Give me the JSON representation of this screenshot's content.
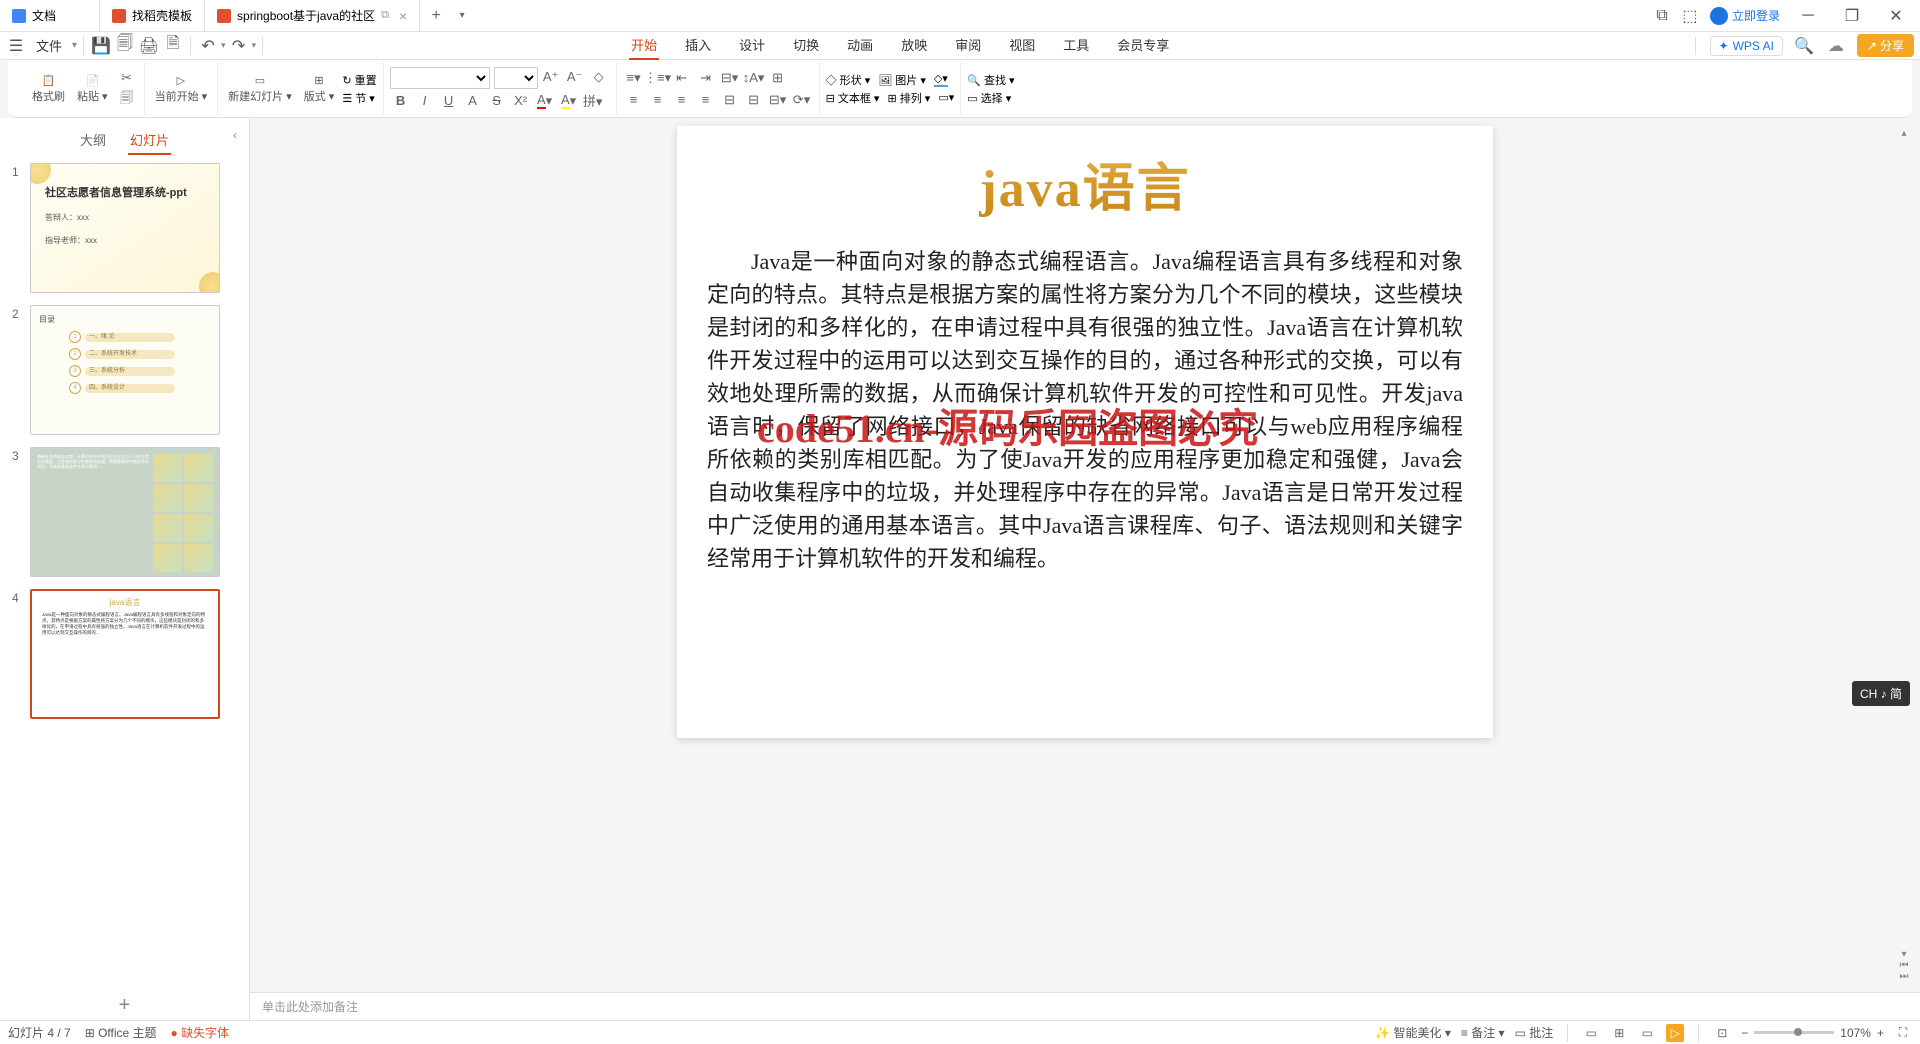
{
  "tabs": [
    {
      "label": "文档",
      "icon_color": "#4285f4"
    },
    {
      "label": "找稻壳模板",
      "icon_color": "#e04f30"
    },
    {
      "label": "springboot基于java的社区",
      "icon_color": "#e04f30",
      "active": true
    }
  ],
  "titlebar": {
    "login_label": "立即登录"
  },
  "file_menu": "文件",
  "menu_tabs": [
    "开始",
    "插入",
    "设计",
    "切换",
    "动画",
    "放映",
    "审阅",
    "视图",
    "工具",
    "会员专享"
  ],
  "active_menu_tab": 0,
  "wps_ai": "WPS AI",
  "share_label": "分享",
  "ribbon": {
    "format_painter": "格式刷",
    "paste": "粘贴",
    "start_from_current": "当前开始",
    "new_slide": "新建幻灯片",
    "layout": "版式",
    "section": "节",
    "reset": "重置",
    "shape": "形状",
    "picture": "图片",
    "textbox": "文本框",
    "arrange": "排列",
    "find": "查找",
    "select": "选择"
  },
  "side_panel": {
    "outline_tab": "大纲",
    "slides_tab": "幻灯片",
    "active_tab": 1
  },
  "thumbs": {
    "slide1": {
      "title": "社区志愿者信息管理系统-ppt",
      "author_label": "答辩人：xxx",
      "teacher_label": "指导老师：xxx"
    },
    "slide2": {
      "title": "目录",
      "items": [
        "一、绪 论",
        "二、系统开发技术",
        "三、系统分析",
        "四、系统设计"
      ]
    },
    "slide4": {
      "title": "java语言"
    }
  },
  "selected_thumb": 4,
  "slide": {
    "title": "java语言",
    "body": "Java是一种面向对象的静态式编程语言。Java编程语言具有多线程和对象定向的特点。其特点是根据方案的属性将方案分为几个不同的模块，这些模块是封闭的和多样化的，在申请过程中具有很强的独立性。Java语言在计算机软件开发过程中的运用可以达到交互操作的目的，通过各种形式的交换，可以有效地处理所需的数据，从而确保计算机软件开发的可控性和可见性。开发java语言时，保留了网络接口，Java保留的缺省网络接口可以与web应用程序编程所依赖的类别库相匹配。为了使Java开发的应用程序更加稳定和强健，Java会自动收集程序中的垃圾，并处理程序中存在的异常。Java语言是日常开发过程中广泛使用的通用基本语言。其中Java语言课程库、句子、语法规则和关键字经常用于计算机软件的开发和编程。",
    "watermark": "code51.cn-源码乐园盗图必究"
  },
  "notes_placeholder": "单击此处添加备注",
  "statusbar": {
    "slide_position": "幻灯片 4 / 7",
    "theme": "Office 主题",
    "missing_fonts": "缺失字体",
    "beautify": "智能美化",
    "notes": "备注",
    "comments": "批注",
    "zoom": "107%"
  },
  "ime": {
    "label": "CH ♪ 简"
  }
}
